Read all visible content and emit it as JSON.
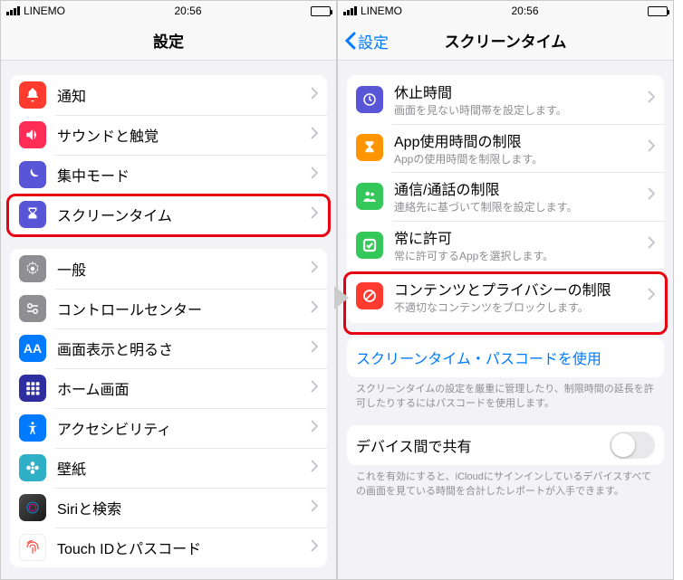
{
  "status": {
    "carrier": "LINEMO",
    "time": "20:56"
  },
  "left": {
    "title": "設定",
    "g1": [
      {
        "label": "通知",
        "icon": "bell",
        "color": "#ff3b30"
      },
      {
        "label": "サウンドと触覚",
        "icon": "speaker",
        "color": "#ff2d55"
      },
      {
        "label": "集中モード",
        "icon": "moon",
        "color": "#5856d6"
      },
      {
        "label": "スクリーンタイム",
        "icon": "hourglass",
        "color": "#5856d6"
      }
    ],
    "g2": [
      {
        "label": "一般",
        "icon": "gear",
        "color": "#8e8e93"
      },
      {
        "label": "コントロールセンター",
        "icon": "switches",
        "color": "#8e8e93"
      },
      {
        "label": "画面表示と明るさ",
        "icon": "aa",
        "color": "#007aff"
      },
      {
        "label": "ホーム画面",
        "icon": "grid",
        "color": "#3a3a9a"
      },
      {
        "label": "アクセシビリティ",
        "icon": "person",
        "color": "#007aff"
      },
      {
        "label": "壁紙",
        "icon": "flower",
        "color": "#30b0c7"
      },
      {
        "label": "Siriと検索",
        "icon": "siri",
        "color": "#222"
      },
      {
        "label": "Touch IDとパスコード",
        "icon": "fingerprint",
        "color": "#ff3b30"
      }
    ]
  },
  "right": {
    "back": "設定",
    "title": "スクリーンタイム",
    "g1": [
      {
        "title": "休止時間",
        "sub": "画面を見ない時間帯を設定します。",
        "icon": "bed",
        "color": "#5856d6"
      },
      {
        "title": "App使用時間の制限",
        "sub": "Appの使用時間を制限します。",
        "icon": "hourglass",
        "color": "#ff9500"
      },
      {
        "title": "通信/通話の制限",
        "sub": "連絡先に基づいて制限を設定します。",
        "icon": "people",
        "color": "#34c759"
      },
      {
        "title": "常に許可",
        "sub": "常に許可するAppを選択します。",
        "icon": "check",
        "color": "#34c759"
      },
      {
        "title": "コンテンツとプライバシーの制限",
        "sub": "不適切なコンテンツをブロックします。",
        "icon": "nosign",
        "color": "#ff3b30"
      }
    ],
    "passcode": "スクリーンタイム・パスコードを使用",
    "passcodeDesc": "スクリーンタイムの設定を厳重に管理したり、制限時間の延長を許可したりするにはパスコードを使用します。",
    "share": "デバイス間で共有",
    "shareDesc": "これを有効にすると、iCloudにサインインしているデバイスすべての画面を見ている時間を合計したレポートが入手できます。"
  }
}
